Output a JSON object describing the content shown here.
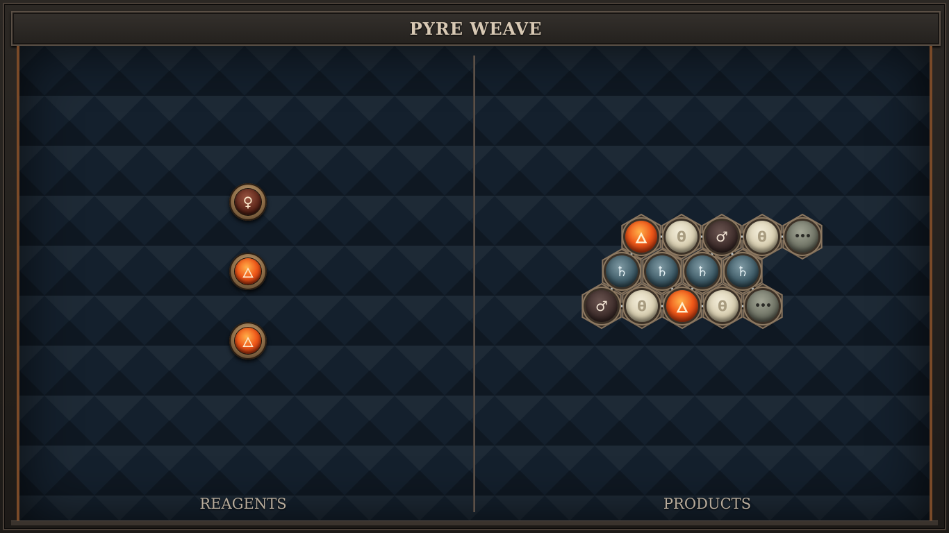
{
  "title": "PYRE WEAVE",
  "panels": {
    "reagents_label": "REAGENTS",
    "products_label": "PRODUCTS"
  },
  "reagents": [
    {
      "element": "venus",
      "symbol": "♀",
      "icon": "venus-icon"
    },
    {
      "element": "fire",
      "symbol": "🜂",
      "icon": "fire-triangle-icon"
    },
    {
      "element": "fire",
      "symbol": "🜂",
      "icon": "fire-triangle-icon"
    }
  ],
  "product": {
    "atoms": [
      {
        "id": "a1",
        "element": "fire",
        "symbol": "🜂",
        "icon": "fire-triangle-icon"
      },
      {
        "id": "a2",
        "element": "salt",
        "symbol": "θ",
        "icon": "salt-icon"
      },
      {
        "id": "a3",
        "element": "mars",
        "symbol": "♂",
        "icon": "mars-icon"
      },
      {
        "id": "a4",
        "element": "salt",
        "symbol": "θ",
        "icon": "salt-icon"
      },
      {
        "id": "a5",
        "element": "quintessence",
        "symbol": "•••",
        "icon": "quintessence-icon"
      },
      {
        "id": "b1",
        "element": "lead",
        "symbol": "♄",
        "icon": "lead-icon"
      },
      {
        "id": "b2",
        "element": "lead",
        "symbol": "♄",
        "icon": "lead-icon"
      },
      {
        "id": "b3",
        "element": "lead",
        "symbol": "♄",
        "icon": "lead-icon"
      },
      {
        "id": "b4",
        "element": "lead",
        "symbol": "♄",
        "icon": "lead-icon"
      },
      {
        "id": "c1",
        "element": "mars",
        "symbol": "♂",
        "icon": "mars-icon"
      },
      {
        "id": "c2",
        "element": "salt",
        "symbol": "θ",
        "icon": "salt-icon"
      },
      {
        "id": "c3",
        "element": "fire",
        "symbol": "🜂",
        "icon": "fire-triangle-icon"
      },
      {
        "id": "c4",
        "element": "salt",
        "symbol": "θ",
        "icon": "salt-icon"
      },
      {
        "id": "c5",
        "element": "quintessence",
        "symbol": "•••",
        "icon": "quintessence-icon"
      }
    ],
    "bonds": [
      [
        "a1",
        "a2"
      ],
      [
        "a2",
        "a3"
      ],
      [
        "a3",
        "a4"
      ],
      [
        "a4",
        "a5"
      ],
      [
        "a1",
        "b1"
      ],
      [
        "b2",
        "c3"
      ],
      [
        "a3",
        "b3"
      ],
      [
        "a3",
        "b4"
      ],
      [
        "b3",
        "c3"
      ],
      [
        "b1",
        "c1"
      ],
      [
        "b4",
        "c5"
      ],
      [
        "c1",
        "c2"
      ],
      [
        "c2",
        "c3"
      ],
      [
        "c3",
        "c4"
      ],
      [
        "c4",
        "c5"
      ]
    ]
  },
  "colors": {
    "frame": "#2c2824",
    "board": "#14202d",
    "accent_rail": "#7a4a28",
    "title_text": "#d8c9b4",
    "label_text": "#b7ab9b"
  }
}
